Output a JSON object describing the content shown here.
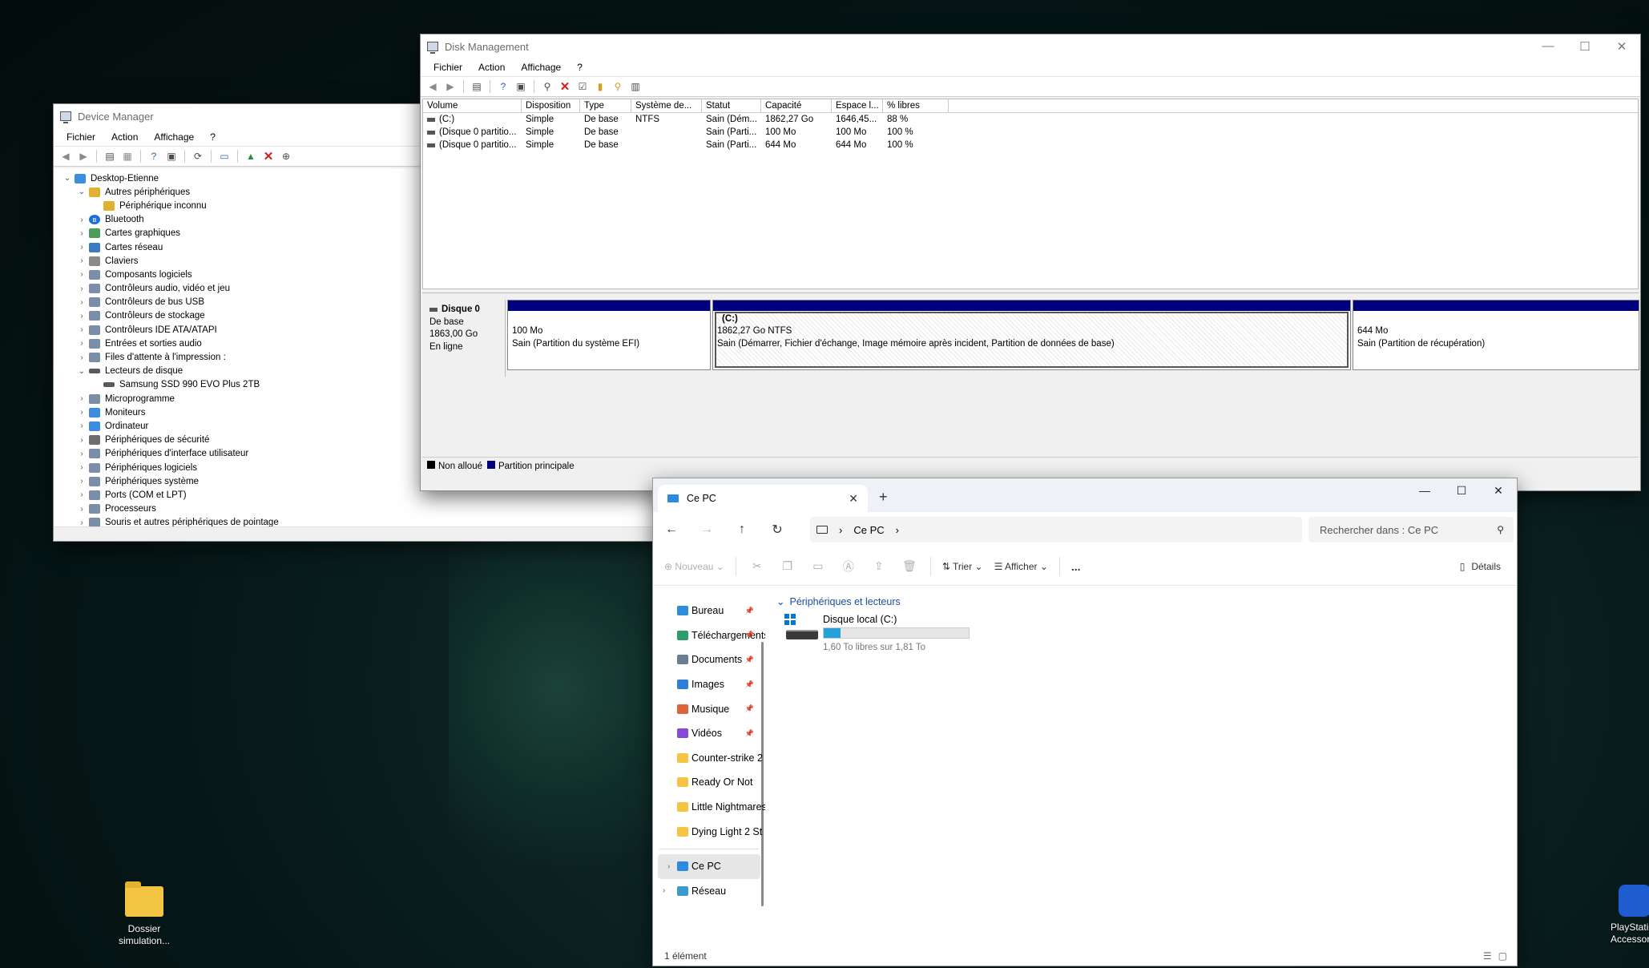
{
  "device_manager": {
    "title": "Device Manager",
    "menu": [
      "Fichier",
      "Action",
      "Affichage",
      "?"
    ],
    "tree": [
      {
        "label": "Desktop-Etienne",
        "level": 0,
        "expanded": true,
        "icon": "computer-icon"
      },
      {
        "label": "Autres périphériques",
        "level": 1,
        "expanded": true,
        "icon": "unknown-device-icon"
      },
      {
        "label": "Périphérique inconnu",
        "level": 2,
        "icon": "warning-device-icon"
      },
      {
        "label": "Bluetooth",
        "level": 1,
        "expanded": false,
        "icon": "bluetooth-icon"
      },
      {
        "label": "Cartes graphiques",
        "level": 1,
        "expanded": false,
        "icon": "display-adapter-icon"
      },
      {
        "label": "Cartes réseau",
        "level": 1,
        "expanded": false,
        "icon": "network-adapter-icon"
      },
      {
        "label": "Claviers",
        "level": 1,
        "expanded": false,
        "icon": "keyboard-icon"
      },
      {
        "label": "Composants logiciels",
        "level": 1,
        "expanded": false,
        "icon": "software-component-icon"
      },
      {
        "label": "Contrôleurs audio, vidéo et jeu",
        "level": 1,
        "expanded": false,
        "icon": "audio-icon"
      },
      {
        "label": "Contrôleurs de bus USB",
        "level": 1,
        "expanded": false,
        "icon": "usb-icon"
      },
      {
        "label": "Contrôleurs de stockage",
        "level": 1,
        "expanded": false,
        "icon": "storage-controller-icon"
      },
      {
        "label": "Contrôleurs IDE ATA/ATAPI",
        "level": 1,
        "expanded": false,
        "icon": "ide-icon"
      },
      {
        "label": "Entrées et sorties audio",
        "level": 1,
        "expanded": false,
        "icon": "speaker-icon"
      },
      {
        "label": "Files d'attente à l'impression :",
        "level": 1,
        "expanded": false,
        "icon": "printer-icon"
      },
      {
        "label": "Lecteurs de disque",
        "level": 1,
        "expanded": true,
        "icon": "disk-drive-icon"
      },
      {
        "label": "Samsung SSD 990 EVO Plus 2TB",
        "level": 2,
        "icon": "disk-icon"
      },
      {
        "label": "Microprogramme",
        "level": 1,
        "expanded": false,
        "icon": "firmware-icon"
      },
      {
        "label": "Moniteurs",
        "level": 1,
        "expanded": false,
        "icon": "monitor-icon"
      },
      {
        "label": "Ordinateur",
        "level": 1,
        "expanded": false,
        "icon": "monitor-icon"
      },
      {
        "label": "Périphériques de sécurité",
        "level": 1,
        "expanded": false,
        "icon": "security-icon"
      },
      {
        "label": "Périphériques d'interface utilisateur",
        "level": 1,
        "expanded": false,
        "icon": "hid-icon"
      },
      {
        "label": "Périphériques logiciels",
        "level": 1,
        "expanded": false,
        "icon": "software-device-icon"
      },
      {
        "label": "Périphériques système",
        "level": 1,
        "expanded": false,
        "icon": "system-device-icon"
      },
      {
        "label": "Ports (COM et LPT)",
        "level": 1,
        "expanded": false,
        "icon": "port-icon"
      },
      {
        "label": "Processeurs",
        "level": 1,
        "expanded": false,
        "icon": "processor-icon"
      },
      {
        "label": "Souris et autres périphériques de pointage",
        "level": 1,
        "expanded": false,
        "icon": "mouse-icon"
      }
    ]
  },
  "disk_management": {
    "title": "Disk Management",
    "menu": [
      "Fichier",
      "Action",
      "Affichage",
      "?"
    ],
    "columns": [
      "Volume",
      "Disposition",
      "Type",
      "Système de...",
      "Statut",
      "Capacité",
      "Espace l...",
      "% libres"
    ],
    "rows": [
      [
        "(C:)",
        "Simple",
        "De base",
        "NTFS",
        "Sain (Dém...",
        "1862,27 Go",
        "1646,45...",
        "88 %"
      ],
      [
        "(Disque 0 partitio...",
        "Simple",
        "De base",
        "",
        "Sain (Parti...",
        "100 Mo",
        "100 Mo",
        "100 %"
      ],
      [
        "(Disque 0 partitio...",
        "Simple",
        "De base",
        "",
        "Sain (Parti...",
        "644 Mo",
        "644 Mo",
        "100 %"
      ]
    ],
    "disk": {
      "name": "Disque 0",
      "type": "De base",
      "size": "1863,00 Go",
      "status": "En ligne"
    },
    "partitions": [
      {
        "label": "",
        "size": "100 Mo",
        "desc": "Sain (Partition du système EFI)"
      },
      {
        "label": "(C:)",
        "size": "1862,27 Go NTFS",
        "desc": "Sain (Démarrer, Fichier d'échange, Image mémoire après incident, Partition de données de base)"
      },
      {
        "label": "",
        "size": "644 Mo",
        "desc": "Sain (Partition de récupération)"
      }
    ],
    "legend": [
      {
        "label": "Non alloué",
        "color": "#000000"
      },
      {
        "label": "Partition principale",
        "color": "#00007f"
      }
    ]
  },
  "explorer": {
    "tab_title": "Ce PC",
    "breadcrumb": [
      "Ce PC"
    ],
    "search_placeholder": "Rechercher dans : Ce PC",
    "commands": {
      "new": "Nouveau",
      "sort": "Trier",
      "view": "Afficher",
      "more": "...",
      "details": "Détails"
    },
    "nav": [
      {
        "label": "Bureau",
        "pinned": true,
        "icon": "desktop-folder-icon",
        "color": "#2d8cdc"
      },
      {
        "label": "Téléchargements",
        "pinned": true,
        "icon": "download-folder-icon",
        "color": "#2e9c6b"
      },
      {
        "label": "Documents",
        "pinned": true,
        "icon": "documents-folder-icon",
        "color": "#6a7d93"
      },
      {
        "label": "Images",
        "pinned": true,
        "icon": "pictures-folder-icon",
        "color": "#2f7fd8"
      },
      {
        "label": "Musique",
        "pinned": true,
        "icon": "music-folder-icon",
        "color": "#e0643a"
      },
      {
        "label": "Vidéos",
        "pinned": true,
        "icon": "videos-folder-icon",
        "color": "#8a4ad8"
      },
      {
        "label": "Counter-strike 2",
        "pinned": false,
        "icon": "folder-icon",
        "color": "#f4c542"
      },
      {
        "label": "Ready Or Not",
        "pinned": false,
        "icon": "folder-icon",
        "color": "#f4c542"
      },
      {
        "label": "Little Nightmares",
        "pinned": false,
        "icon": "folder-icon",
        "color": "#f4c542"
      },
      {
        "label": "Dying Light 2 St",
        "pinned": false,
        "icon": "folder-icon",
        "color": "#f4c542"
      }
    ],
    "nav_bottom": [
      {
        "label": "Ce PC",
        "icon": "this-pc-icon",
        "selected": true
      },
      {
        "label": "Réseau",
        "icon": "network-icon",
        "selected": false
      }
    ],
    "group": "Périphériques et lecteurs",
    "drive": {
      "name": "Disque local (C:)",
      "free_text": "1,60 To libres sur 1,81 To",
      "used_fraction": 0.116
    },
    "status": "1 élément"
  },
  "desktop": {
    "folder_label": "Dossier simulation...",
    "ps_label": "PlayStation Accessories"
  }
}
